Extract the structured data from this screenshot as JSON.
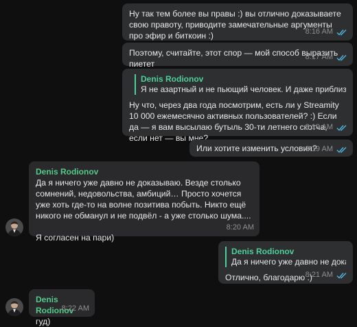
{
  "messages": [
    {
      "text": "Ну так тем более вы правы :) вы отлично доказываете свою правоту, приводите замечательные аргументы про эфир и биткоин :)",
      "time": "8:16 AM"
    },
    {
      "text": "Поэтому, считайте, этот спор — мой способ выразить пиетет",
      "time": "8:17 AM"
    },
    {
      "quote_name": "Denis Rodionov",
      "quote_text": "Я не азартный и не пьющий человек. И даже приблизительно",
      "text": "Ну что, через два года посмотрим, есть ли у Streamity 10 000 ежемесячно активных пользователей? :) Если да — я вам высылаю бутыль 30-ти летнего скотча, если нет — вы мне?",
      "time": "8:19 AM"
    },
    {
      "text": "Или хотите изменить условия?",
      "time": "8:19 AM"
    },
    {
      "sender": "Denis Rodionov",
      "text": "Да я ничего уже давно не доказываю. Везде столько сомнений, недовольства, амбиций… Просто хочется уже хоть где-то на волне позитива побыть. Никто ещё никого не обманул и не подвёл - а уже столько шума....\n\nЯ согласен на пари)",
      "time": "8:20 AM"
    },
    {
      "quote_name": "Denis Rodionov",
      "quote_text": "Да я ничего уже давно не доказ",
      "text": "Отлично, благодарю :)",
      "time": "8:21 AM"
    },
    {
      "sender": "Denis Rodionov",
      "text": "гуд)",
      "time": "8:22 AM"
    }
  ],
  "colors": {
    "accent": "#4fcf9a",
    "check": "#4fb5e0"
  },
  "icons": {
    "read_receipt": "double-check-icon",
    "avatar": "user-avatar"
  }
}
